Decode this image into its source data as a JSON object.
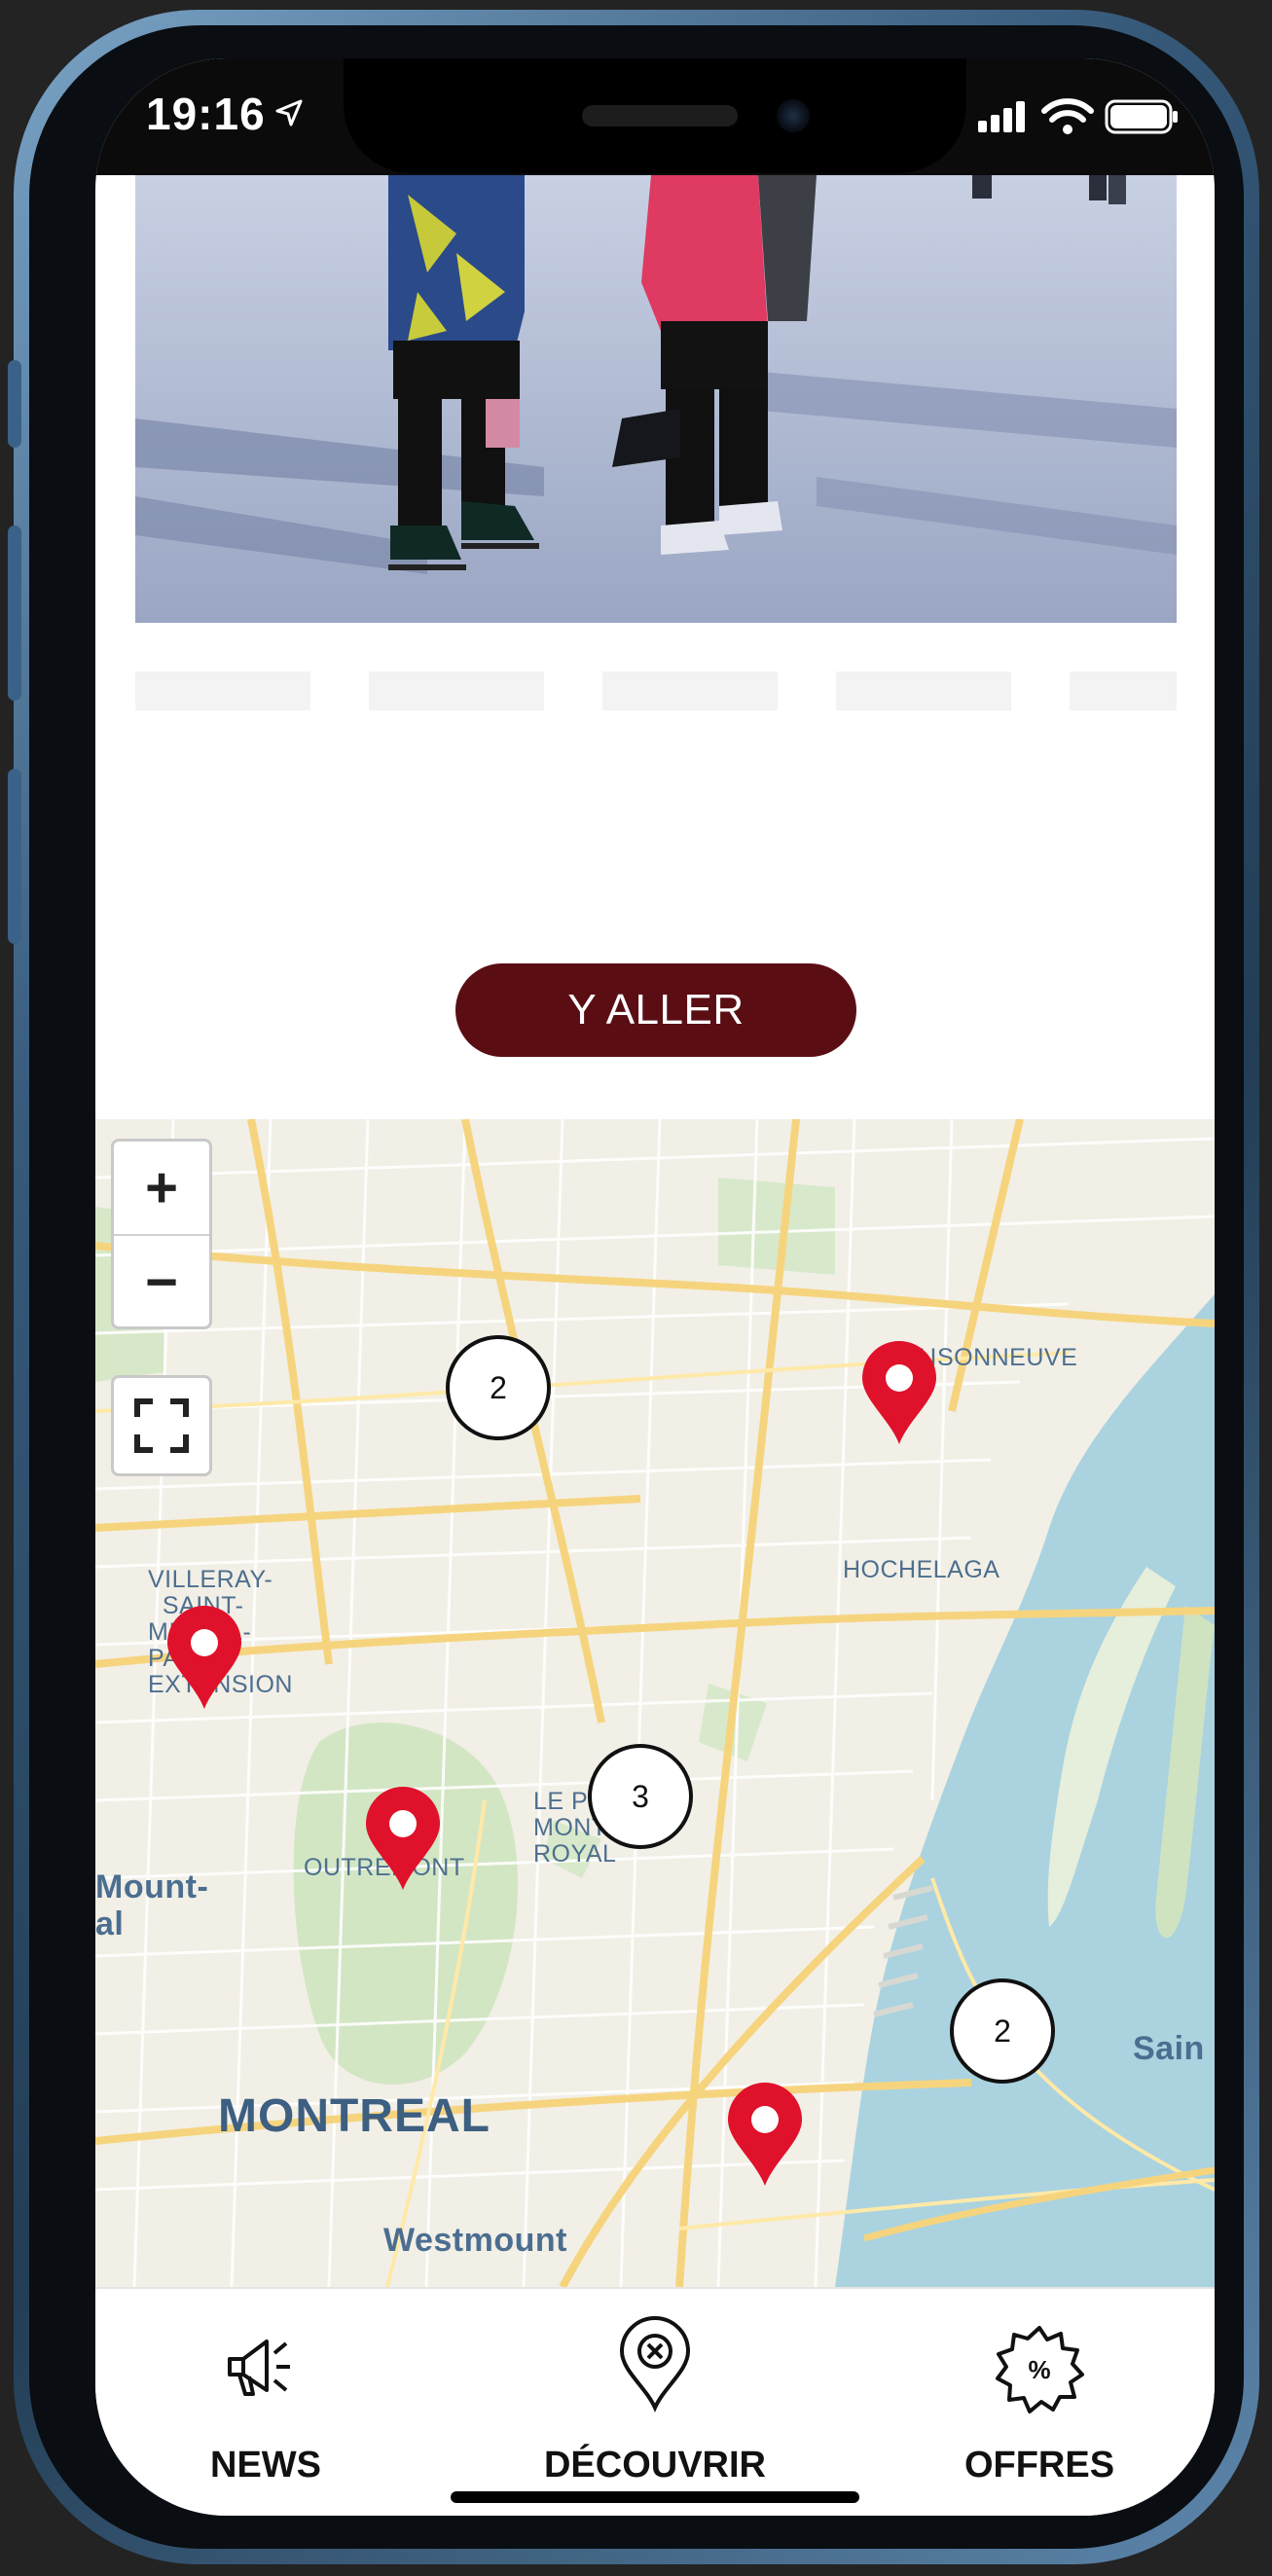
{
  "status_bar": {
    "time": "19:16"
  },
  "content": {
    "goto_button_label": "Y ALLER"
  },
  "map": {
    "zoom_in_label": "+",
    "zoom_out_label": "−",
    "labels": {
      "maisonneuve": "MAISONNEUVE",
      "hochelaga": "HOCHELAGA",
      "villeray": "VILLERAY-\n  SAINT-\nMICHEL-\nPARC-\nEXTENSION",
      "outremont": "OUTREMONT",
      "plateau": "LE PLATEAU-\nMONT-\nROYAL",
      "mount_royal": "Mount-\nal",
      "montreal": "MONTREAL",
      "westmount": "Westmount",
      "saint": "Sain"
    },
    "clusters": [
      {
        "count": "2"
      },
      {
        "count": "3"
      },
      {
        "count": "2"
      }
    ],
    "marker_color": "#e0112b"
  },
  "tabbar": {
    "tabs": [
      {
        "label": "NEWS",
        "icon": "megaphone-icon"
      },
      {
        "label": "DÉCOUVRIR",
        "icon": "map-pin-icon"
      },
      {
        "label": "OFFRES",
        "icon": "discount-badge-icon"
      }
    ]
  },
  "colors": {
    "button_bg": "#5a0e14",
    "marker": "#e0112b"
  }
}
